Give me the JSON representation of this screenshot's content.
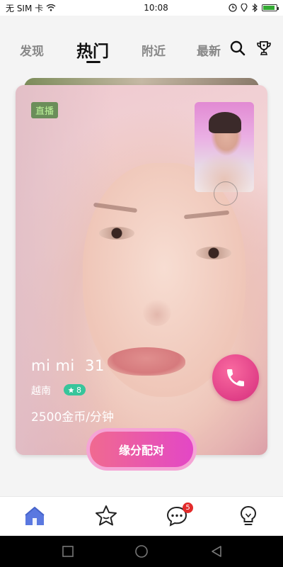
{
  "status_bar": {
    "carrier": "无 SIM 卡",
    "time": "10:08"
  },
  "top_nav": {
    "tabs": [
      {
        "label": "发现",
        "active": false
      },
      {
        "label": "热门",
        "active": true
      },
      {
        "label": "附近",
        "active": false
      },
      {
        "label": "最新",
        "active": false
      }
    ],
    "icons": [
      "search-icon",
      "trophy-icon"
    ]
  },
  "card": {
    "live_label": "直播",
    "name": "mi mi",
    "age": "31",
    "country": "越南",
    "level": "8",
    "price": "2500金币/分钟",
    "call_icon": "phone-icon",
    "match_label": "缘分配对"
  },
  "bottom_nav": {
    "items": [
      {
        "icon": "home-icon",
        "active": true
      },
      {
        "icon": "star-face-icon",
        "active": false
      },
      {
        "icon": "chat-icon",
        "active": false,
        "badge": "5"
      },
      {
        "icon": "lightbulb-icon",
        "active": false
      }
    ]
  },
  "colors": {
    "accent_pink": "#e03f87",
    "match_gradient_start": "#f06a90",
    "match_gradient_end": "#e347c6",
    "active_home": "#5a78e0",
    "level_badge": "#37c59b",
    "live_badge": "#6b8e5a"
  }
}
